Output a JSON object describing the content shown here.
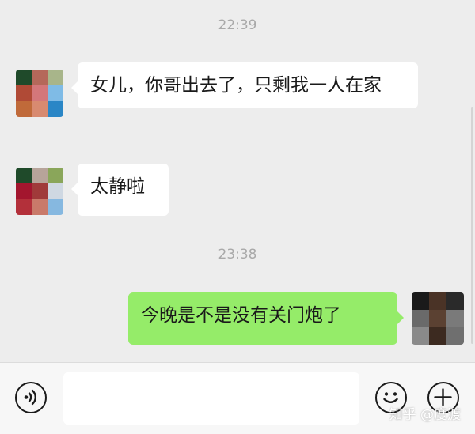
{
  "chat": {
    "messages": [
      {
        "type": "time",
        "text": "22:39"
      },
      {
        "type": "received",
        "text": "女儿，你哥出去了，只剩我一人在家"
      },
      {
        "type": "received",
        "text": "太静啦"
      },
      {
        "type": "time",
        "text": "23:38"
      },
      {
        "type": "sent",
        "text": "今晚是不是没有关门炮了"
      }
    ]
  },
  "input_bar": {
    "voice_icon": "voice-icon",
    "emoji_icon": "emoji-icon",
    "plus_icon": "plus-icon",
    "message_value": ""
  },
  "watermark": "知乎 @度渡",
  "colors": {
    "background": "#ededed",
    "received_bubble": "#ffffff",
    "sent_bubble": "#95ec69",
    "timestamp": "#a9a9a9",
    "input_bar": "#f7f7f7"
  }
}
